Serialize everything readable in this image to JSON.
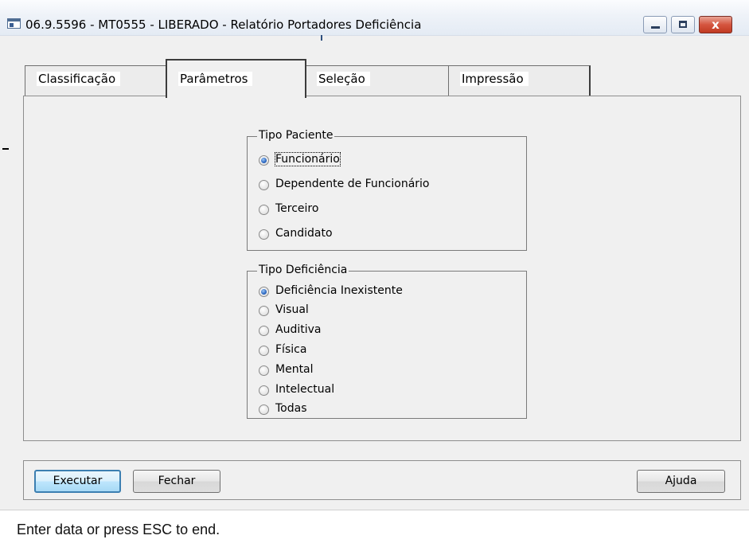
{
  "window": {
    "title": "06.9.5596 - MT0555 - LIBERADO - Relatório Portadores Deficiência",
    "icons": {
      "app": "app-window-icon",
      "minimize": "minimize-icon",
      "maximize": "maximize-icon",
      "close": "close-icon"
    },
    "close_glyph": "x"
  },
  "tabs": [
    {
      "label": "Classificação",
      "active": false
    },
    {
      "label": "Parâmetros",
      "active": true
    },
    {
      "label": "Seleção",
      "active": false
    },
    {
      "label": "Impressão",
      "active": false
    }
  ],
  "tipo_paciente": {
    "legend": "Tipo Paciente",
    "options": [
      {
        "label": "Funcionário",
        "selected": true
      },
      {
        "label": "Dependente de Funcionário",
        "selected": false
      },
      {
        "label": "Terceiro",
        "selected": false
      },
      {
        "label": "Candidato",
        "selected": false
      }
    ]
  },
  "tipo_deficiencia": {
    "legend": "Tipo Deficiência",
    "options": [
      {
        "label": "Deficiência Inexistente",
        "selected": true
      },
      {
        "label": "Visual",
        "selected": false
      },
      {
        "label": "Auditiva",
        "selected": false
      },
      {
        "label": "Física",
        "selected": false
      },
      {
        "label": "Mental",
        "selected": false
      },
      {
        "label": "Intelectual",
        "selected": false
      },
      {
        "label": "Todas",
        "selected": false
      }
    ]
  },
  "buttons": {
    "execute": "Executar",
    "close": "Fechar",
    "help": "Ajuda"
  },
  "status": {
    "message": "Enter data or press ESC to end."
  },
  "colors": {
    "accent": "#2a66c0",
    "close_button": "#c03a22",
    "default_button_border": "#3c7fb1"
  }
}
